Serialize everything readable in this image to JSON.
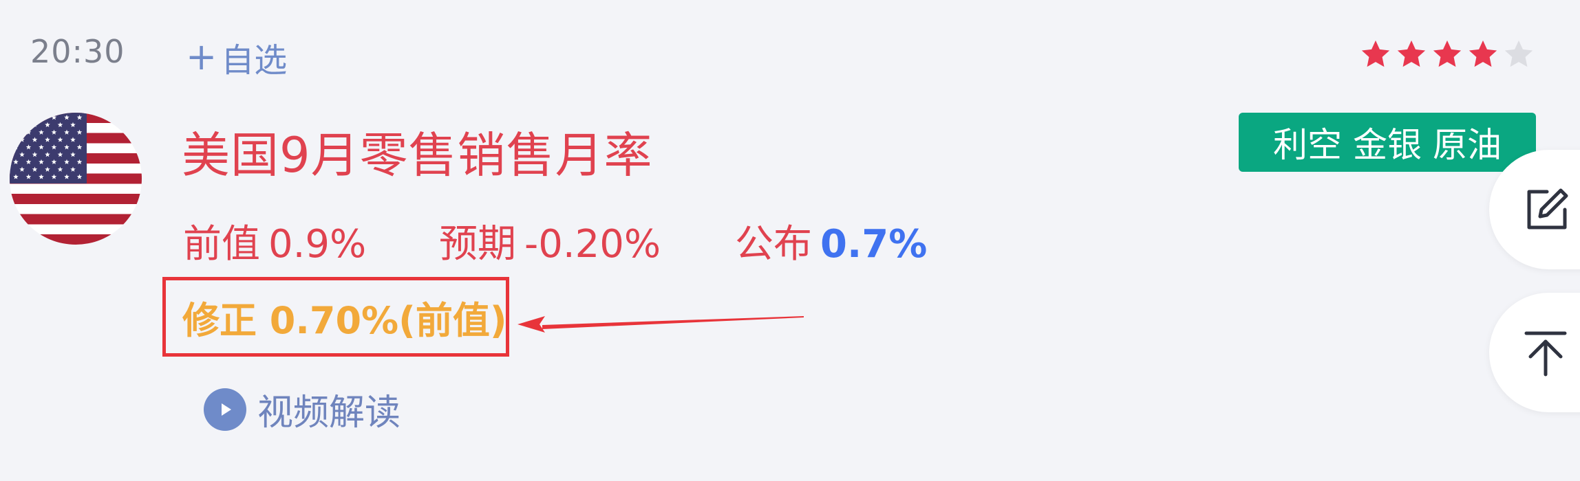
{
  "event": {
    "time": "20:30",
    "add_watchlist": {
      "icon": "plus-icon",
      "label": "自选"
    },
    "importance": {
      "rating": 4,
      "max": 5,
      "filled_color": "#e8374f",
      "empty_color": "#dcdde2"
    },
    "country_flag": "us-flag-icon",
    "title": "美国9月零售销售月率",
    "tags": [
      "利空",
      "金银",
      "原油"
    ],
    "tag_color": "#0aa781",
    "previous": {
      "label": "前值",
      "value": "0.9%"
    },
    "forecast": {
      "label": "预期",
      "value": "-0.20%"
    },
    "actual": {
      "label": "公布",
      "value": "0.7%",
      "color": "#3f72f0"
    },
    "revision": "修正 0.70%(前值)",
    "revision_color": "#f2a93a",
    "video": {
      "icon": "play-icon",
      "label": "视频解读"
    }
  },
  "side_actions": {
    "edit": {
      "icon": "edit-icon"
    },
    "back_to_top": {
      "icon": "back-to-top-icon"
    }
  },
  "annotation": {
    "highlight_color": "#e8343a"
  }
}
